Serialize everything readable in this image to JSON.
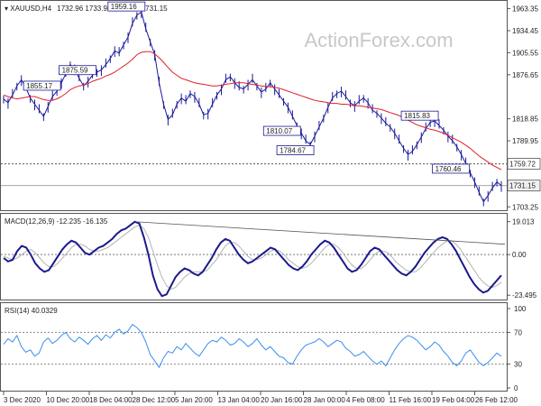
{
  "header": {
    "symbol": "XAUUSD,H4",
    "ohlc": "1732.96 1733.96 1731.00 1731.15"
  },
  "watermark": "ActionForex.com",
  "colors": {
    "price": "#1a1a9a",
    "ma": "#e0202a",
    "macd": "#1a1a8c",
    "signal": "#b4b4b4",
    "rsi": "#3a8ef0",
    "box_border": "#1a1a9a",
    "tag_bg": "#ffffff"
  },
  "chart_data": [
    {
      "type": "line",
      "title": "XAUUSD,H4",
      "y_ticks": [
        "1963.35",
        "1934.45",
        "1905.55",
        "1876.65",
        "1818.85",
        "1789.95",
        "1703.25"
      ],
      "ylim": [
        1700,
        1970
      ],
      "labels": [
        "1959.16",
        "1875.59",
        "1855.17",
        "1810.07",
        "1815.83",
        "1784.67",
        "1760.46"
      ],
      "price_tags": [
        "1759.72",
        "1731.15"
      ],
      "dotted_level": 1759.72,
      "last_price": 1731.15,
      "series": [
        {
          "values": [
            1845,
            1840,
            1850,
            1862,
            1870,
            1860,
            1846,
            1838,
            1830,
            1822,
            1835,
            1848,
            1855,
            1866,
            1878,
            1890,
            1884,
            1872,
            1862,
            1868,
            1876,
            1880,
            1883,
            1890,
            1898,
            1908,
            1905,
            1916,
            1926,
            1944,
            1955,
            1959,
            1937,
            1920,
            1903,
            1866,
            1838,
            1818,
            1824,
            1838,
            1846,
            1842,
            1852,
            1848,
            1838,
            1824,
            1826,
            1838,
            1850,
            1858,
            1870,
            1874,
            1866,
            1860,
            1858,
            1864,
            1870,
            1862,
            1854,
            1858,
            1866,
            1858,
            1850,
            1842,
            1834,
            1822,
            1810,
            1800,
            1790,
            1785,
            1796,
            1808,
            1820,
            1834,
            1846,
            1852,
            1855,
            1848,
            1840,
            1836,
            1842,
            1846,
            1840,
            1830,
            1826,
            1820,
            1813,
            1808,
            1800,
            1790,
            1780,
            1772,
            1776,
            1785,
            1795,
            1806,
            1814,
            1816,
            1810,
            1804,
            1796,
            1790,
            1782,
            1772,
            1760,
            1748,
            1736,
            1722,
            1710,
            1718,
            1728,
            1736,
            1731
          ]
        },
        {
          "values": [
            1850,
            1848,
            1846,
            1845,
            1846,
            1847,
            1848,
            1848,
            1846,
            1844,
            1843,
            1843,
            1845,
            1848,
            1852,
            1857,
            1860,
            1862,
            1863,
            1865,
            1868,
            1870,
            1872,
            1875,
            1877,
            1880,
            1884,
            1888,
            1892,
            1897,
            1903,
            1906,
            1907,
            1907,
            1904,
            1899,
            1893,
            1886,
            1880,
            1876,
            1872,
            1870,
            1868,
            1866,
            1865,
            1864,
            1863,
            1862,
            1862,
            1863,
            1864,
            1865,
            1866,
            1866,
            1866,
            1865,
            1864,
            1863,
            1862,
            1861,
            1861,
            1860,
            1859,
            1857,
            1855,
            1853,
            1851,
            1849,
            1847,
            1845,
            1843,
            1842,
            1841,
            1840,
            1839,
            1839,
            1838,
            1838,
            1837,
            1836,
            1836,
            1835,
            1834,
            1833,
            1832,
            1831,
            1829,
            1827,
            1825,
            1823,
            1820,
            1817,
            1814,
            1811,
            1809,
            1807,
            1805,
            1804,
            1802,
            1800,
            1797,
            1794,
            1791,
            1788,
            1784,
            1780,
            1775,
            1770,
            1766,
            1762,
            1758,
            1755,
            1752
          ]
        }
      ]
    },
    {
      "type": "line",
      "title": "MACD(12,26,9) -12.235 -16.135",
      "y_ticks": [
        "19.013",
        "0.00",
        "-23.495"
      ],
      "ylim": [
        -26,
        22
      ],
      "series": [
        {
          "values": [
            -2,
            -4,
            -3,
            2,
            5,
            4,
            0,
            -5,
            -8,
            -10,
            -9,
            -5,
            -1,
            3,
            6,
            8,
            7,
            4,
            1,
            0,
            2,
            4,
            5,
            7,
            9,
            12,
            14,
            15,
            17,
            19,
            18,
            10,
            0,
            -12,
            -20,
            -24,
            -23,
            -18,
            -13,
            -10,
            -8,
            -9,
            -11,
            -12,
            -10,
            -6,
            -2,
            3,
            7,
            9,
            8,
            4,
            0,
            -3,
            -5,
            -4,
            -2,
            0,
            2,
            4,
            3,
            0,
            -3,
            -6,
            -8,
            -9,
            -7,
            -4,
            0,
            3,
            6,
            8,
            7,
            4,
            0,
            -4,
            -8,
            -10,
            -9,
            -6,
            -2,
            2,
            4,
            3,
            0,
            -3,
            -6,
            -9,
            -11,
            -12,
            -10,
            -7,
            -3,
            1,
            4,
            7,
            9,
            10,
            9,
            6,
            2,
            -3,
            -8,
            -13,
            -17,
            -20,
            -22,
            -21,
            -18,
            -15,
            -12
          ]
        },
        {
          "values": [
            -1,
            -2,
            -3,
            -2,
            0,
            2,
            3,
            1,
            -2,
            -5,
            -7,
            -7,
            -5,
            -2,
            1,
            4,
            6,
            6,
            5,
            3,
            2,
            2,
            3,
            4,
            6,
            8,
            10,
            12,
            14,
            16,
            17,
            15,
            10,
            2,
            -6,
            -13,
            -18,
            -20,
            -19,
            -16,
            -13,
            -11,
            -10,
            -10,
            -10,
            -9,
            -6,
            -3,
            1,
            5,
            7,
            7,
            5,
            2,
            -1,
            -3,
            -3,
            -2,
            0,
            2,
            3,
            2,
            0,
            -3,
            -5,
            -7,
            -8,
            -7,
            -5,
            -2,
            1,
            4,
            6,
            6,
            4,
            1,
            -3,
            -6,
            -8,
            -8,
            -6,
            -3,
            0,
            2,
            2,
            1,
            -2,
            -5,
            -7,
            -9,
            -10,
            -10,
            -8,
            -5,
            -2,
            1,
            4,
            6,
            8,
            8,
            6,
            3,
            -1,
            -5,
            -9,
            -13,
            -16,
            -18,
            -19,
            -18,
            -16
          ]
        }
      ]
    },
    {
      "type": "line",
      "title": "RSI(14) 40.0329",
      "y_ticks": [
        "100",
        "70",
        "30",
        "0"
      ],
      "ylim": [
        0,
        100
      ],
      "series": [
        {
          "values": [
            55,
            62,
            58,
            66,
            52,
            45,
            48,
            40,
            44,
            58,
            63,
            56,
            60,
            66,
            70,
            62,
            58,
            64,
            60,
            55,
            62,
            66,
            60,
            67,
            63,
            70,
            74,
            68,
            72,
            80,
            76,
            70,
            58,
            42,
            34,
            26,
            38,
            46,
            44,
            52,
            48,
            56,
            50,
            44,
            40,
            48,
            56,
            60,
            58,
            64,
            60,
            54,
            56,
            62,
            58,
            52,
            56,
            62,
            54,
            48,
            52,
            46,
            40,
            38,
            32,
            30,
            40,
            48,
            54,
            56,
            58,
            62,
            58,
            52,
            56,
            60,
            58,
            50,
            46,
            40,
            42,
            46,
            40,
            34,
            30,
            34,
            28,
            38,
            48,
            56,
            62,
            66,
            64,
            60,
            54,
            48,
            52,
            58,
            54,
            46,
            40,
            32,
            28,
            34,
            44,
            48,
            40,
            32,
            28,
            32,
            38,
            44,
            40
          ]
        }
      ]
    }
  ],
  "x_axis_labels": [
    "3 Dec 2020",
    "10 Dec 20:00",
    "18 Dec 04:00",
    "28 Dec 12:00",
    "5 Jan 20:00",
    "13 Jan 04:00",
    "20 Jan 16:00",
    "28 Jan 00:00",
    "4 Feb 08:00",
    "11 Feb 16:00",
    "19 Feb 04:00",
    "26 Feb 12:00"
  ]
}
